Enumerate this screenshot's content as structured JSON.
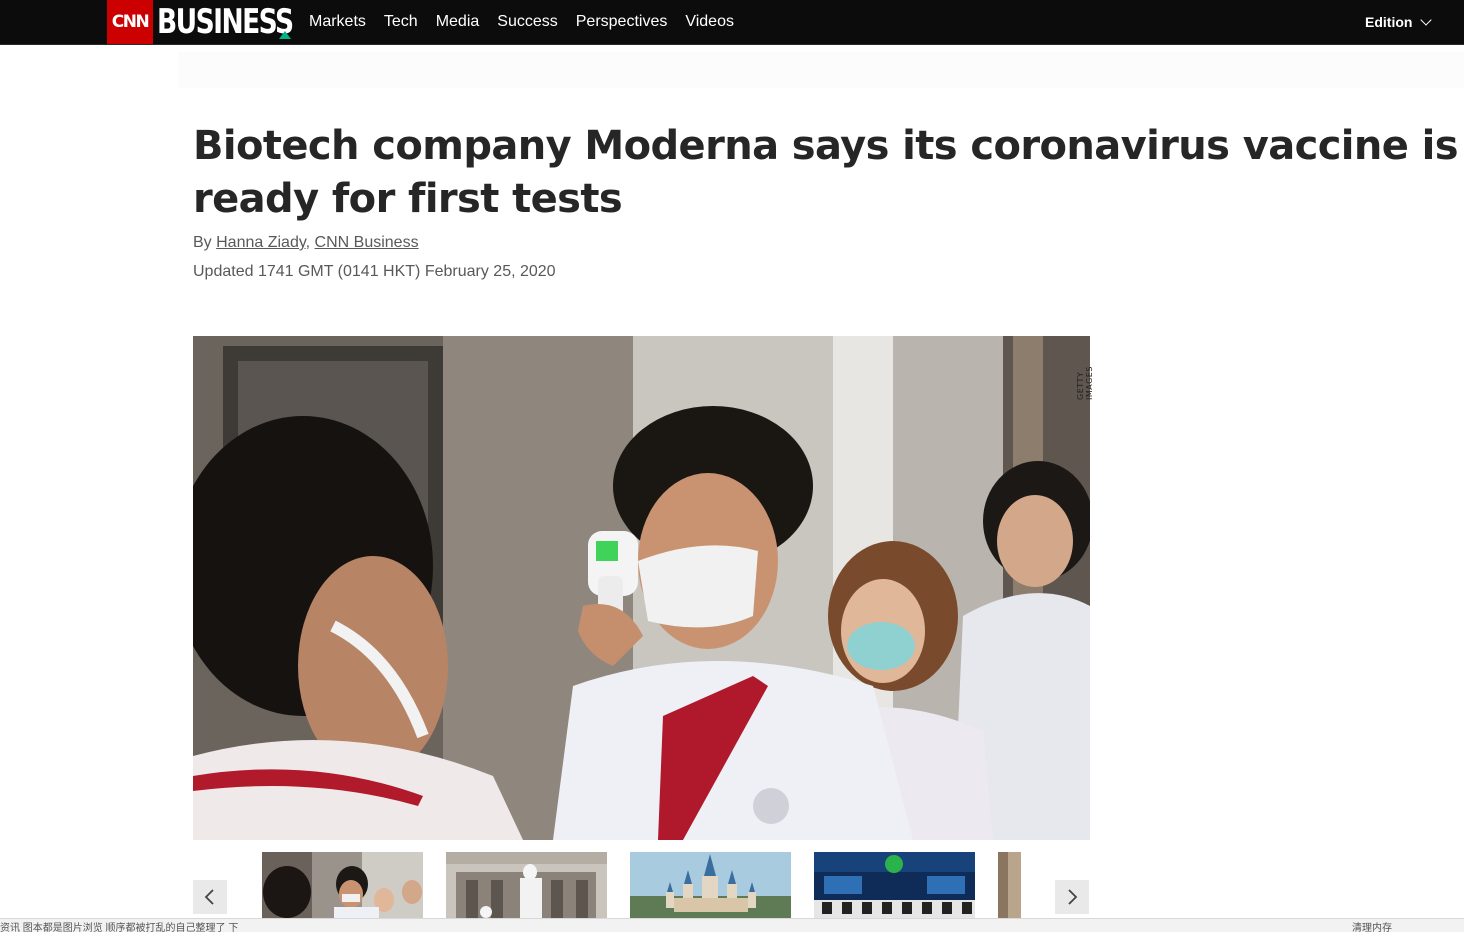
{
  "nav": {
    "cnn_logo": "CNN",
    "brand": "BUSINESS",
    "links": [
      "Markets",
      "Tech",
      "Media",
      "Success",
      "Perspectives",
      "Videos"
    ],
    "edition_label": "Edition",
    "colors": {
      "bar": "#0c0c0c",
      "cnn_red": "#cc0000",
      "business_accent": "#00b386"
    }
  },
  "article": {
    "headline": "Biotech company Moderna says its coronavirus vaccine is ready for first tests",
    "byline_prefix": "By",
    "author": "Hanna Ziady",
    "byline_separator": ", ",
    "outlet": "CNN Business",
    "updated": "Updated 1741 GMT (0141 HKT) February 25, 2020"
  },
  "hero": {
    "credit": "GETTY IMAGES"
  },
  "gallery": {
    "prev_icon": "chevron-left-icon",
    "next_icon": "chevron-right-icon"
  },
  "statusbar": {
    "left_text": "资讯 图本都是图片浏览 顺序都被打乱的自己整理了 下",
    "right_text": "清理内存"
  }
}
